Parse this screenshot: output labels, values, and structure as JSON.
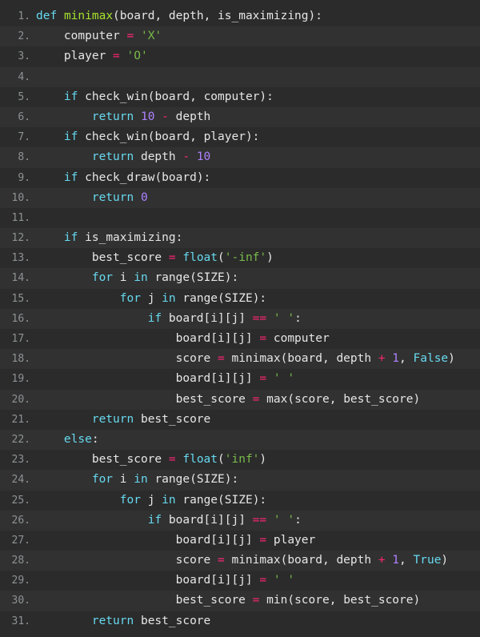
{
  "editor": {
    "language": "python",
    "colors": {
      "background": "#2b2b2b",
      "alt_row": "#313131",
      "line_number": "#8e9294",
      "keyword": "#66d9ef",
      "function": "#a6e22e",
      "string": "#79bb4a",
      "number": "#ae81ff",
      "operator": "#f92672",
      "text": "#e6e6e6"
    },
    "lines": [
      {
        "n": "1.",
        "tokens": [
          [
            "kw",
            "def"
          ],
          [
            "ws",
            " "
          ],
          [
            "fn",
            "minimax"
          ],
          [
            "pu",
            "("
          ],
          [
            "id",
            "board"
          ],
          [
            "pu",
            ", "
          ],
          [
            "id",
            "depth"
          ],
          [
            "pu",
            ", "
          ],
          [
            "id",
            "is_maximizing"
          ],
          [
            "pu",
            "):"
          ]
        ]
      },
      {
        "n": "2.",
        "tokens": [
          [
            "ws",
            "    "
          ],
          [
            "id",
            "computer"
          ],
          [
            "ws",
            " "
          ],
          [
            "op",
            "="
          ],
          [
            "ws",
            " "
          ],
          [
            "st",
            "'X'"
          ]
        ]
      },
      {
        "n": "3.",
        "tokens": [
          [
            "ws",
            "    "
          ],
          [
            "id",
            "player"
          ],
          [
            "ws",
            " "
          ],
          [
            "op",
            "="
          ],
          [
            "ws",
            " "
          ],
          [
            "st",
            "'O'"
          ]
        ]
      },
      {
        "n": "4.",
        "tokens": []
      },
      {
        "n": "5.",
        "tokens": [
          [
            "ws",
            "    "
          ],
          [
            "kw",
            "if"
          ],
          [
            "ws",
            " "
          ],
          [
            "id",
            "check_win"
          ],
          [
            "pu",
            "("
          ],
          [
            "id",
            "board"
          ],
          [
            "pu",
            ", "
          ],
          [
            "id",
            "computer"
          ],
          [
            "pu",
            "):"
          ]
        ]
      },
      {
        "n": "6.",
        "tokens": [
          [
            "ws",
            "        "
          ],
          [
            "kw",
            "return"
          ],
          [
            "ws",
            " "
          ],
          [
            "nu",
            "10"
          ],
          [
            "ws",
            " "
          ],
          [
            "op",
            "-"
          ],
          [
            "ws",
            " "
          ],
          [
            "id",
            "depth"
          ]
        ]
      },
      {
        "n": "7.",
        "tokens": [
          [
            "ws",
            "    "
          ],
          [
            "kw",
            "if"
          ],
          [
            "ws",
            " "
          ],
          [
            "id",
            "check_win"
          ],
          [
            "pu",
            "("
          ],
          [
            "id",
            "board"
          ],
          [
            "pu",
            ", "
          ],
          [
            "id",
            "player"
          ],
          [
            "pu",
            "):"
          ]
        ]
      },
      {
        "n": "8.",
        "tokens": [
          [
            "ws",
            "        "
          ],
          [
            "kw",
            "return"
          ],
          [
            "ws",
            " "
          ],
          [
            "id",
            "depth"
          ],
          [
            "ws",
            " "
          ],
          [
            "op",
            "-"
          ],
          [
            "ws",
            " "
          ],
          [
            "nu",
            "10"
          ]
        ]
      },
      {
        "n": "9.",
        "tokens": [
          [
            "ws",
            "    "
          ],
          [
            "kw",
            "if"
          ],
          [
            "ws",
            " "
          ],
          [
            "id",
            "check_draw"
          ],
          [
            "pu",
            "("
          ],
          [
            "id",
            "board"
          ],
          [
            "pu",
            "):"
          ]
        ]
      },
      {
        "n": "10.",
        "tokens": [
          [
            "ws",
            "        "
          ],
          [
            "kw",
            "return"
          ],
          [
            "ws",
            " "
          ],
          [
            "nu",
            "0"
          ]
        ]
      },
      {
        "n": "11.",
        "tokens": []
      },
      {
        "n": "12.",
        "tokens": [
          [
            "ws",
            "    "
          ],
          [
            "kw",
            "if"
          ],
          [
            "ws",
            " "
          ],
          [
            "id",
            "is_maximizing"
          ],
          [
            "pu",
            ":"
          ]
        ]
      },
      {
        "n": "13.",
        "tokens": [
          [
            "ws",
            "        "
          ],
          [
            "id",
            "best_score"
          ],
          [
            "ws",
            " "
          ],
          [
            "op",
            "="
          ],
          [
            "ws",
            " "
          ],
          [
            "bi",
            "float"
          ],
          [
            "pu",
            "("
          ],
          [
            "st",
            "'-inf'"
          ],
          [
            "pu",
            ")"
          ]
        ]
      },
      {
        "n": "14.",
        "tokens": [
          [
            "ws",
            "        "
          ],
          [
            "kw",
            "for"
          ],
          [
            "ws",
            " "
          ],
          [
            "id",
            "i"
          ],
          [
            "ws",
            " "
          ],
          [
            "kw",
            "in"
          ],
          [
            "ws",
            " "
          ],
          [
            "id",
            "range"
          ],
          [
            "pu",
            "("
          ],
          [
            "id",
            "SIZE"
          ],
          [
            "pu",
            "):"
          ]
        ]
      },
      {
        "n": "15.",
        "tokens": [
          [
            "ws",
            "            "
          ],
          [
            "kw",
            "for"
          ],
          [
            "ws",
            " "
          ],
          [
            "id",
            "j"
          ],
          [
            "ws",
            " "
          ],
          [
            "kw",
            "in"
          ],
          [
            "ws",
            " "
          ],
          [
            "id",
            "range"
          ],
          [
            "pu",
            "("
          ],
          [
            "id",
            "SIZE"
          ],
          [
            "pu",
            "):"
          ]
        ]
      },
      {
        "n": "16.",
        "tokens": [
          [
            "ws",
            "                "
          ],
          [
            "kw",
            "if"
          ],
          [
            "ws",
            " "
          ],
          [
            "id",
            "board"
          ],
          [
            "pu",
            "[i][j]"
          ],
          [
            "ws",
            " "
          ],
          [
            "op",
            "=="
          ],
          [
            "ws",
            " "
          ],
          [
            "st",
            "' '"
          ],
          [
            "pu",
            ":"
          ]
        ]
      },
      {
        "n": "17.",
        "tokens": [
          [
            "ws",
            "                    "
          ],
          [
            "id",
            "board"
          ],
          [
            "pu",
            "[i][j]"
          ],
          [
            "ws",
            " "
          ],
          [
            "op",
            "="
          ],
          [
            "ws",
            " "
          ],
          [
            "id",
            "computer"
          ]
        ]
      },
      {
        "n": "18.",
        "tokens": [
          [
            "ws",
            "                    "
          ],
          [
            "id",
            "score"
          ],
          [
            "ws",
            " "
          ],
          [
            "op",
            "="
          ],
          [
            "ws",
            " "
          ],
          [
            "id",
            "minimax"
          ],
          [
            "pu",
            "("
          ],
          [
            "id",
            "board"
          ],
          [
            "pu",
            ", "
          ],
          [
            "id",
            "depth"
          ],
          [
            "ws",
            " "
          ],
          [
            "op",
            "+"
          ],
          [
            "ws",
            " "
          ],
          [
            "nu",
            "1"
          ],
          [
            "pu",
            ", "
          ],
          [
            "bo",
            "False"
          ],
          [
            "pu",
            ")"
          ]
        ]
      },
      {
        "n": "19.",
        "tokens": [
          [
            "ws",
            "                    "
          ],
          [
            "id",
            "board"
          ],
          [
            "pu",
            "[i][j]"
          ],
          [
            "ws",
            " "
          ],
          [
            "op",
            "="
          ],
          [
            "ws",
            " "
          ],
          [
            "st",
            "' '"
          ]
        ]
      },
      {
        "n": "20.",
        "tokens": [
          [
            "ws",
            "                    "
          ],
          [
            "id",
            "best_score"
          ],
          [
            "ws",
            " "
          ],
          [
            "op",
            "="
          ],
          [
            "ws",
            " "
          ],
          [
            "id",
            "max"
          ],
          [
            "pu",
            "("
          ],
          [
            "id",
            "score"
          ],
          [
            "pu",
            ", "
          ],
          [
            "id",
            "best_score"
          ],
          [
            "pu",
            ")"
          ]
        ]
      },
      {
        "n": "21.",
        "tokens": [
          [
            "ws",
            "        "
          ],
          [
            "kw",
            "return"
          ],
          [
            "ws",
            " "
          ],
          [
            "id",
            "best_score"
          ]
        ]
      },
      {
        "n": "22.",
        "tokens": [
          [
            "ws",
            "    "
          ],
          [
            "kw",
            "else"
          ],
          [
            "pu",
            ":"
          ]
        ]
      },
      {
        "n": "23.",
        "tokens": [
          [
            "ws",
            "        "
          ],
          [
            "id",
            "best_score"
          ],
          [
            "ws",
            " "
          ],
          [
            "op",
            "="
          ],
          [
            "ws",
            " "
          ],
          [
            "bi",
            "float"
          ],
          [
            "pu",
            "("
          ],
          [
            "st",
            "'inf'"
          ],
          [
            "pu",
            ")"
          ]
        ]
      },
      {
        "n": "24.",
        "tokens": [
          [
            "ws",
            "        "
          ],
          [
            "kw",
            "for"
          ],
          [
            "ws",
            " "
          ],
          [
            "id",
            "i"
          ],
          [
            "ws",
            " "
          ],
          [
            "kw",
            "in"
          ],
          [
            "ws",
            " "
          ],
          [
            "id",
            "range"
          ],
          [
            "pu",
            "("
          ],
          [
            "id",
            "SIZE"
          ],
          [
            "pu",
            "):"
          ]
        ]
      },
      {
        "n": "25.",
        "tokens": [
          [
            "ws",
            "            "
          ],
          [
            "kw",
            "for"
          ],
          [
            "ws",
            " "
          ],
          [
            "id",
            "j"
          ],
          [
            "ws",
            " "
          ],
          [
            "kw",
            "in"
          ],
          [
            "ws",
            " "
          ],
          [
            "id",
            "range"
          ],
          [
            "pu",
            "("
          ],
          [
            "id",
            "SIZE"
          ],
          [
            "pu",
            "):"
          ]
        ]
      },
      {
        "n": "26.",
        "tokens": [
          [
            "ws",
            "                "
          ],
          [
            "kw",
            "if"
          ],
          [
            "ws",
            " "
          ],
          [
            "id",
            "board"
          ],
          [
            "pu",
            "[i][j]"
          ],
          [
            "ws",
            " "
          ],
          [
            "op",
            "=="
          ],
          [
            "ws",
            " "
          ],
          [
            "st",
            "' '"
          ],
          [
            "pu",
            ":"
          ]
        ]
      },
      {
        "n": "27.",
        "tokens": [
          [
            "ws",
            "                    "
          ],
          [
            "id",
            "board"
          ],
          [
            "pu",
            "[i][j]"
          ],
          [
            "ws",
            " "
          ],
          [
            "op",
            "="
          ],
          [
            "ws",
            " "
          ],
          [
            "id",
            "player"
          ]
        ]
      },
      {
        "n": "28.",
        "tokens": [
          [
            "ws",
            "                    "
          ],
          [
            "id",
            "score"
          ],
          [
            "ws",
            " "
          ],
          [
            "op",
            "="
          ],
          [
            "ws",
            " "
          ],
          [
            "id",
            "minimax"
          ],
          [
            "pu",
            "("
          ],
          [
            "id",
            "board"
          ],
          [
            "pu",
            ", "
          ],
          [
            "id",
            "depth"
          ],
          [
            "ws",
            " "
          ],
          [
            "op",
            "+"
          ],
          [
            "ws",
            " "
          ],
          [
            "nu",
            "1"
          ],
          [
            "pu",
            ", "
          ],
          [
            "bo",
            "True"
          ],
          [
            "pu",
            ")"
          ]
        ]
      },
      {
        "n": "29.",
        "tokens": [
          [
            "ws",
            "                    "
          ],
          [
            "id",
            "board"
          ],
          [
            "pu",
            "[i][j]"
          ],
          [
            "ws",
            " "
          ],
          [
            "op",
            "="
          ],
          [
            "ws",
            " "
          ],
          [
            "st",
            "' '"
          ]
        ]
      },
      {
        "n": "30.",
        "tokens": [
          [
            "ws",
            "                    "
          ],
          [
            "id",
            "best_score"
          ],
          [
            "ws",
            " "
          ],
          [
            "op",
            "="
          ],
          [
            "ws",
            " "
          ],
          [
            "id",
            "min"
          ],
          [
            "pu",
            "("
          ],
          [
            "id",
            "score"
          ],
          [
            "pu",
            ", "
          ],
          [
            "id",
            "best_score"
          ],
          [
            "pu",
            ")"
          ]
        ]
      },
      {
        "n": "31.",
        "tokens": [
          [
            "ws",
            "        "
          ],
          [
            "kw",
            "return"
          ],
          [
            "ws",
            " "
          ],
          [
            "id",
            "best_score"
          ]
        ]
      }
    ]
  }
}
